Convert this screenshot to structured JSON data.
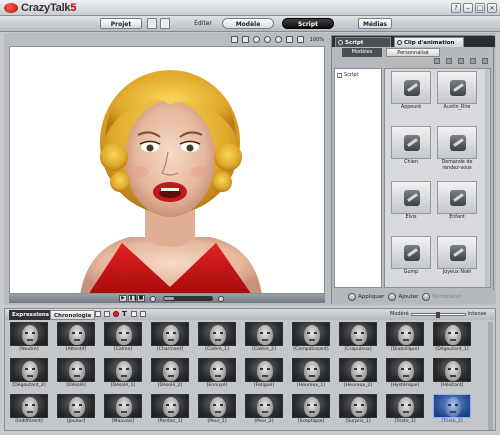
{
  "app": {
    "name": "CrazyTalk",
    "version": "5"
  },
  "window_buttons": [
    "?",
    "–",
    "□",
    "×"
  ],
  "topmenu": {
    "projet": "Projet",
    "editer": "Éditer",
    "modele": "Modèle",
    "script": "Script",
    "medias": "Médias"
  },
  "viewer": {
    "zoom": "100%"
  },
  "right_panel": {
    "tab_script": "Script",
    "tab_clip": "Clip d'animation",
    "subtab_modeles": "Modèles",
    "subtab_perso": "Personnalisé",
    "tree_root": "Script",
    "clips": [
      {
        "label": "Appeuré"
      },
      {
        "label": "Austin_Rire"
      },
      {
        "label": "Chien"
      },
      {
        "label": "Demande de rendez-vous"
      },
      {
        "label": "Elvis"
      },
      {
        "label": "Enfant"
      },
      {
        "label": "Gump"
      },
      {
        "label": "Joyeux Noël"
      }
    ],
    "apply_label": "Appliquer",
    "add_label": "Ajouter",
    "replace_label": "Remplacer"
  },
  "bottom_panel": {
    "tab_expressions": "Expressions",
    "tab_chronologie": "Chronologie",
    "modere_label": "Modéré",
    "intense_label": "Intense",
    "faces": [
      "[Neutre]",
      "[Attentif]",
      "[Calme]",
      "[Charmant]",
      "[Colère_1]",
      "[Colère_2]",
      "[Compatissant]",
      "[Crapuleux]",
      "[Diabolique]",
      "[Dégoutant_1]",
      "[Dégoutant_2]",
      "[Désolé]",
      "[Désolé_1]",
      "[Désolé_2]",
      "[Ennuyé]",
      "[Fatigué]",
      "[Heureux_1]",
      "[Heureux_2]",
      "[Hystérique]",
      "[Hésitant]",
      "[Indifférent]",
      "[Joueur]",
      "[Mauvais]",
      "[Pardon_1]",
      "[Peur_1]",
      "[Peur_2]",
      "[Sceptique]",
      "[Surpris_1]",
      "[Triste_1]",
      "[Triste_2]"
    ],
    "selected_face": "[Triste_2]"
  },
  "colors": {
    "accent_red": "#c40000",
    "selected_blue": "#1b3f8a",
    "dress_red": "#d11a1a",
    "hair_yellow": "#e9b52a"
  }
}
